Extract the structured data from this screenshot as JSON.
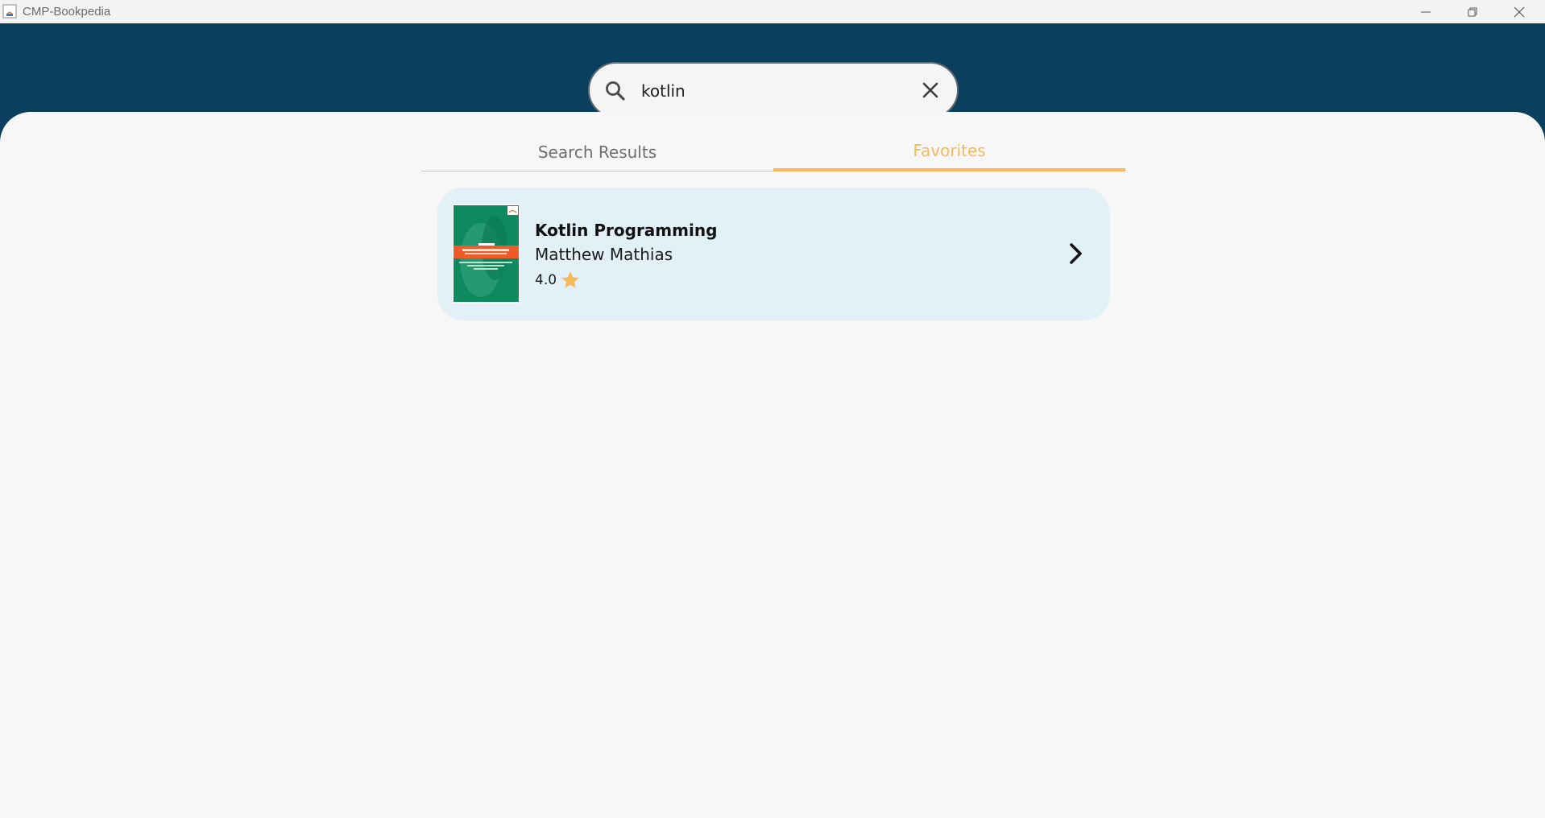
{
  "window": {
    "title": "CMP-Bookpedia"
  },
  "search": {
    "value": "kotlin",
    "icon": "search-icon",
    "clear_icon": "close-icon"
  },
  "tabs": [
    {
      "label": "Search Results",
      "selected": false
    },
    {
      "label": "Favorites",
      "selected": true
    }
  ],
  "colors": {
    "header": "#0b3f5e",
    "accent": "#f7b85c",
    "card": "#e2f0f8",
    "background": "#f7f7f7"
  },
  "favorites": [
    {
      "title": "Kotlin Programming",
      "author": "Matthew Mathias",
      "rating": "4.0",
      "rating_icon": "star-icon",
      "action_icon": "chevron-right-icon"
    }
  ]
}
